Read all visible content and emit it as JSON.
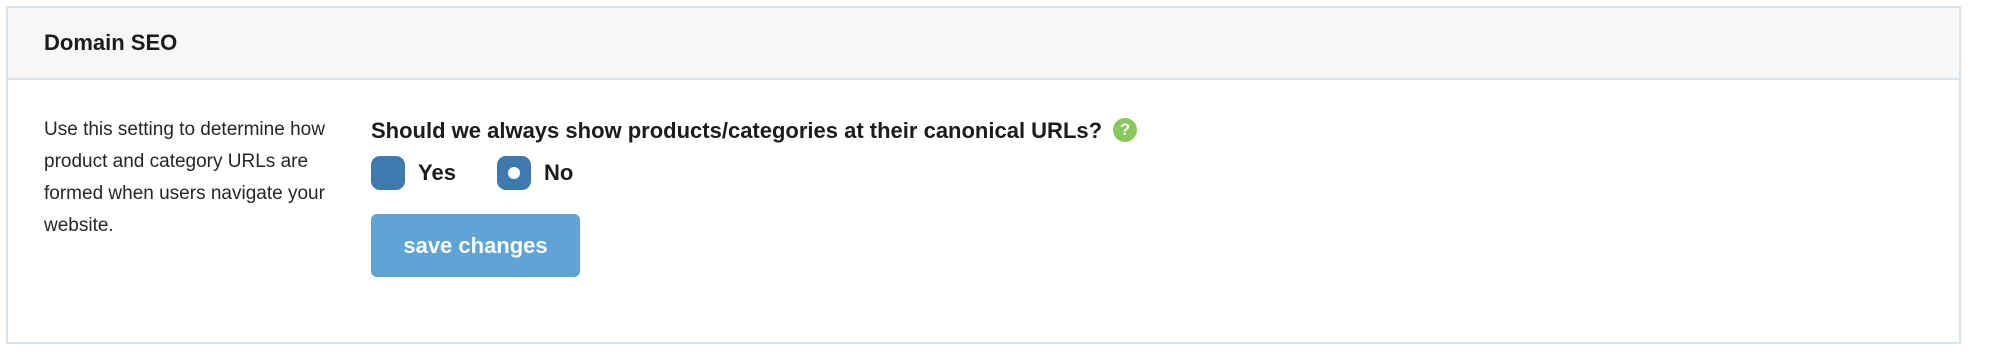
{
  "panel": {
    "title": "Domain SEO"
  },
  "description": "Use this setting to determine how product and category URLs are formed when users navigate your website.",
  "setting": {
    "question": "Should we always show products/categories at their canonical URLs?",
    "help_icon_glyph": "?",
    "options": [
      {
        "label": "Yes",
        "selected": false
      },
      {
        "label": "No",
        "selected": true
      }
    ]
  },
  "save_button": {
    "label": "save changes"
  },
  "colors": {
    "accent": "#3e7aae",
    "button": "#60a3d6",
    "help_icon": "#8ac85a",
    "header_bg": "#f7f7f7",
    "border": "#dbe3ea"
  }
}
